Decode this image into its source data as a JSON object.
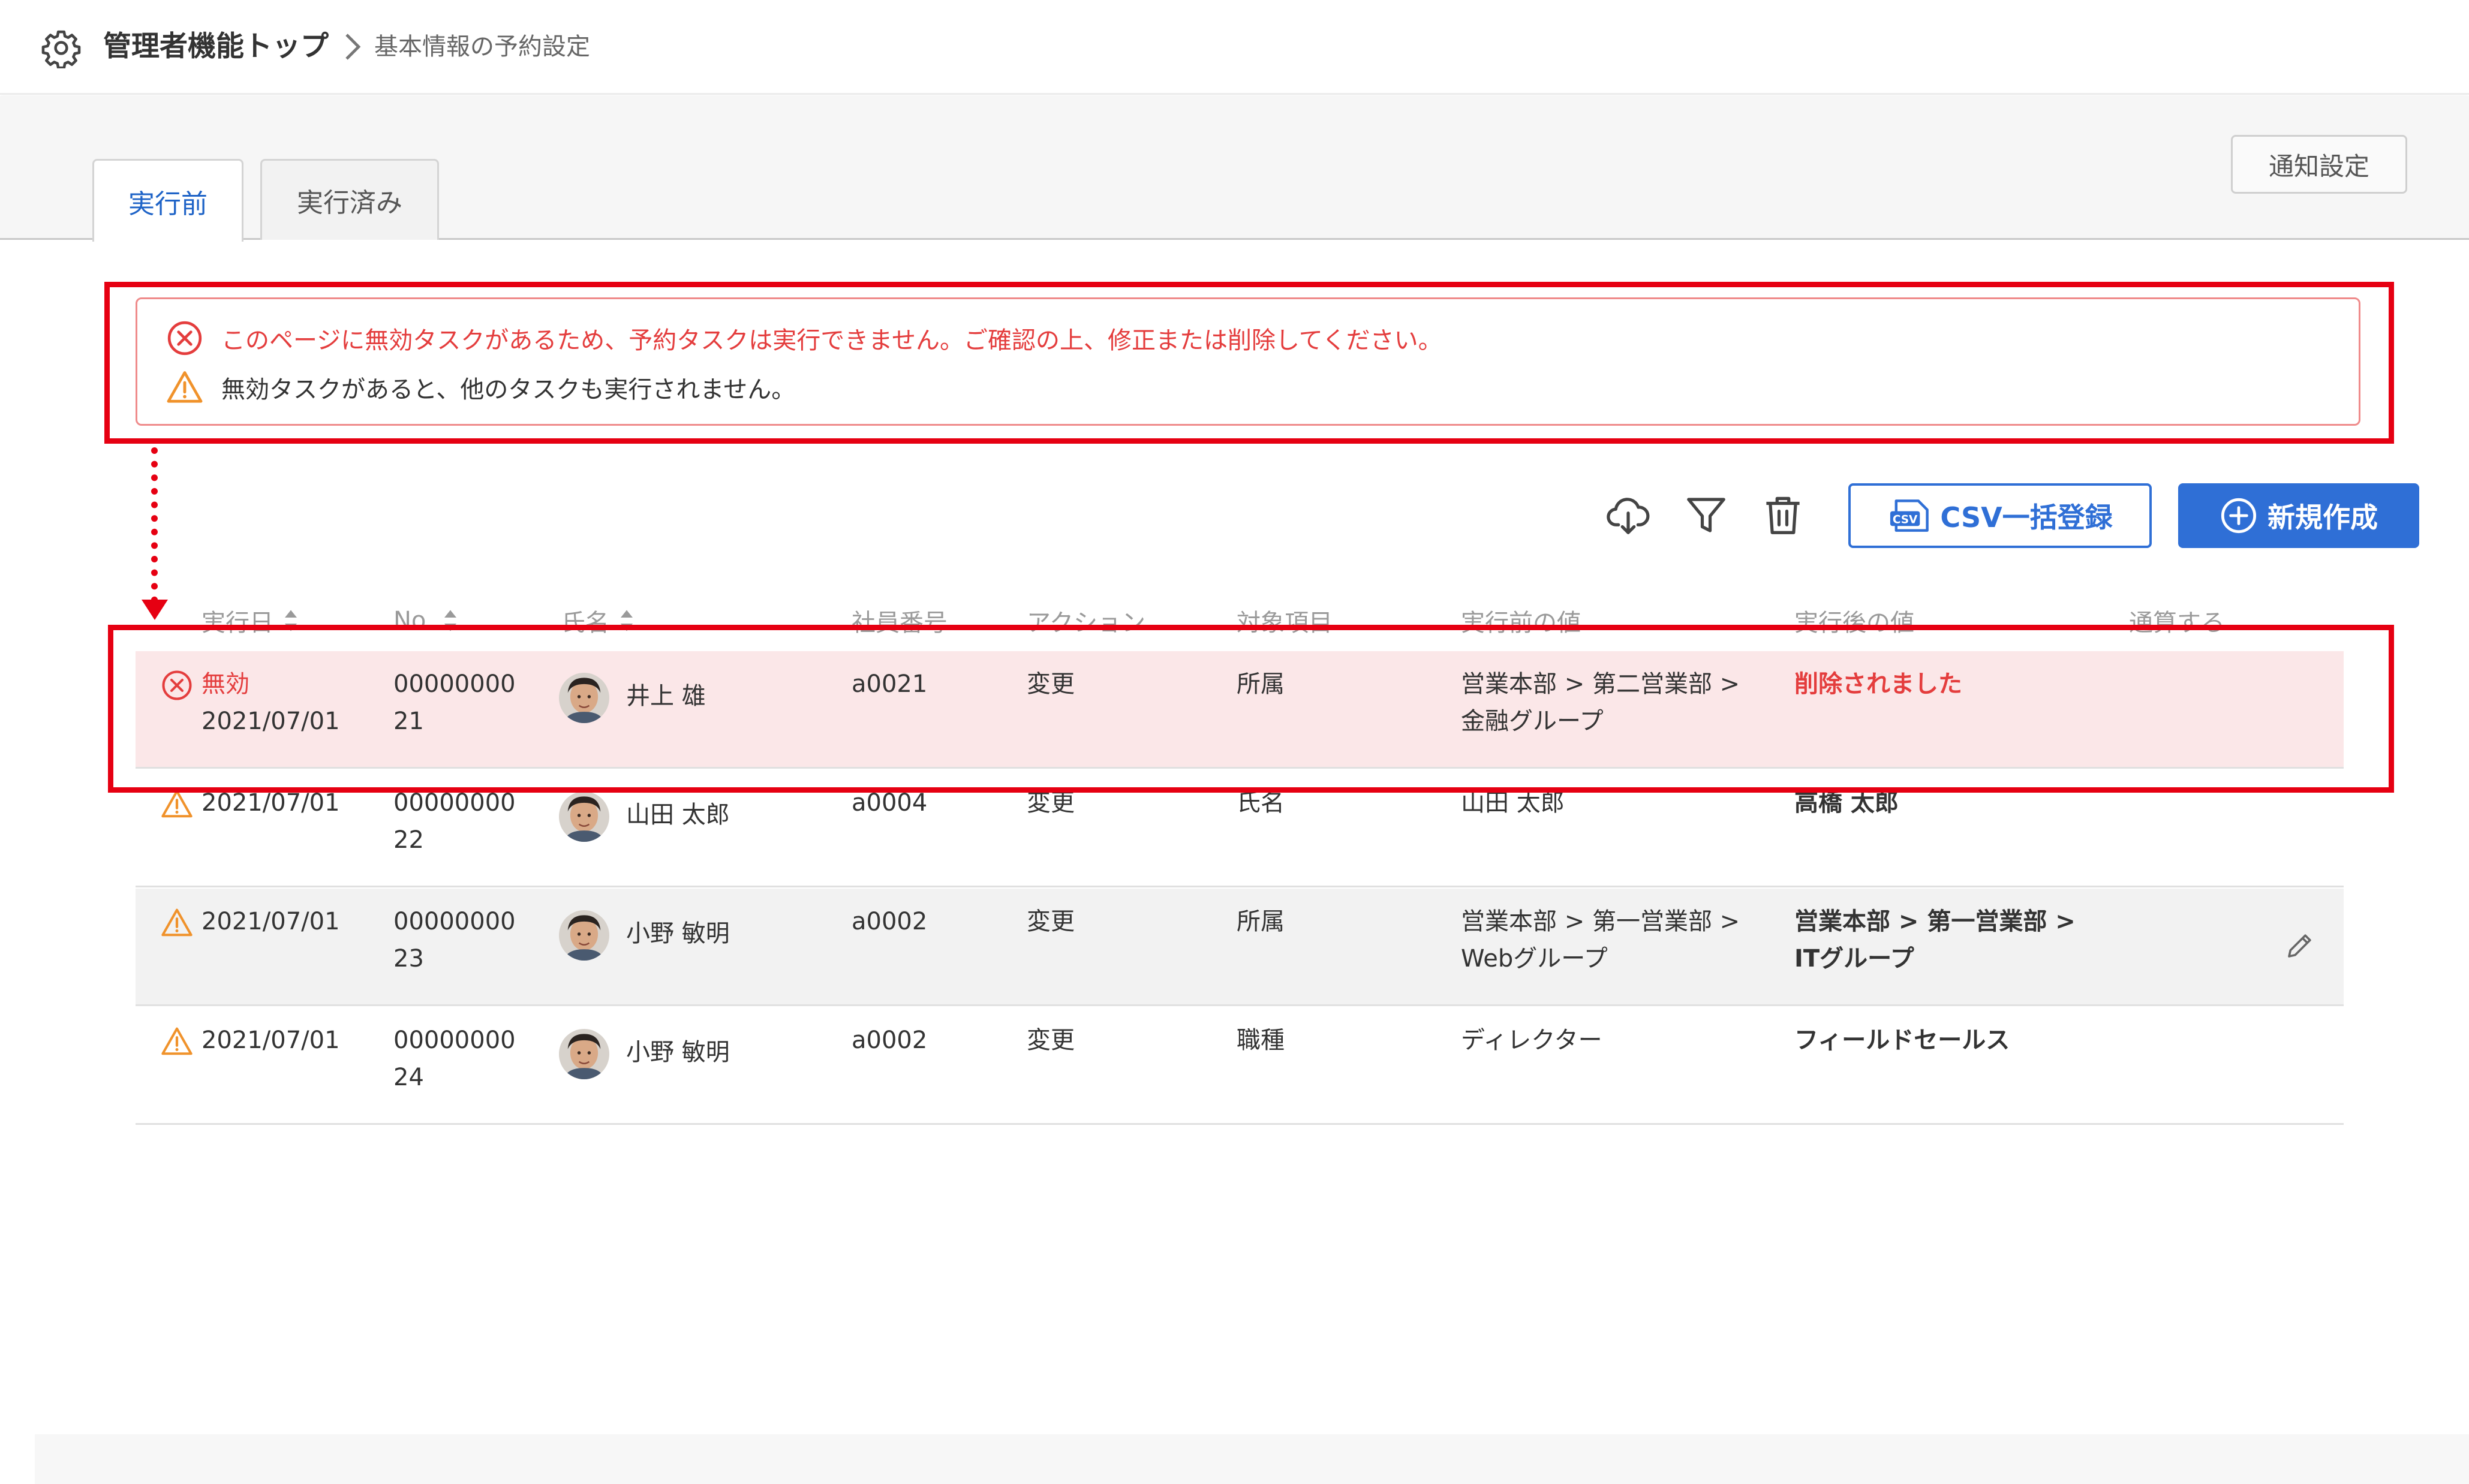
{
  "header": {
    "breadcrumb_root": "管理者機能トップ",
    "breadcrumb_current": "基本情報の予約設定"
  },
  "tabs": [
    {
      "label": "実行前",
      "active": true
    },
    {
      "label": "実行済み",
      "active": false
    }
  ],
  "notify_button": "通知設定",
  "alerts": {
    "error": "このページに無効タスクがあるため、予約タスクは実行できません。ご確認の上、修正または削除してください。",
    "warning": "無効タスクがあると、他のタスクも実行されません。"
  },
  "toolbar": {
    "csv_label": "CSV一括登録",
    "new_label": "新規作成",
    "icons": [
      "cloud-download-icon",
      "filter-icon",
      "trash-icon"
    ]
  },
  "table": {
    "columns": [
      "実行日",
      "No.",
      "氏名",
      "社員番号",
      "アクション",
      "対象項目",
      "実行前の値",
      "実行後の値",
      "通算する"
    ],
    "rows": [
      {
        "status": "invalid",
        "status_label": "無効",
        "date": "2021/07/01",
        "no_line1": "00000000",
        "no_line2": "21",
        "name": "井上 雄",
        "employee_id": "a0021",
        "action": "変更",
        "target": "所属",
        "before_line1": "営業本部 > 第二営業部 >",
        "before_line2": "金融グループ",
        "after_line1": "削除されました",
        "after_line2": ""
      },
      {
        "status": "warning",
        "status_label": "",
        "date": "2021/07/01",
        "no_line1": "00000000",
        "no_line2": "22",
        "name": "山田 太郎",
        "employee_id": "a0004",
        "action": "変更",
        "target": "氏名",
        "before_line1": "山田 太郎",
        "before_line2": "",
        "after_line1": "高橋 太郎",
        "after_line2": ""
      },
      {
        "status": "warning",
        "status_label": "",
        "date": "2021/07/01",
        "no_line1": "00000000",
        "no_line2": "23",
        "name": "小野 敏明",
        "employee_id": "a0002",
        "action": "変更",
        "target": "所属",
        "before_line1": "営業本部 > 第一営業部 >",
        "before_line2": "Webグループ",
        "after_line1": "営業本部 > 第一営業部 >",
        "after_line2": "ITグループ"
      },
      {
        "status": "warning",
        "status_label": "",
        "date": "2021/07/01",
        "no_line1": "00000000",
        "no_line2": "24",
        "name": "小野 敏明",
        "employee_id": "a0002",
        "action": "変更",
        "target": "職種",
        "before_line1": "ディレクター",
        "before_line2": "",
        "after_line1": "フィールドセールス",
        "after_line2": ""
      }
    ]
  },
  "colors": {
    "accent": "#2f6fd6",
    "error": "#e43d3d",
    "warning": "#f0922b",
    "annotation": "#e60012",
    "invalid_row_bg": "#fbe7e8"
  }
}
